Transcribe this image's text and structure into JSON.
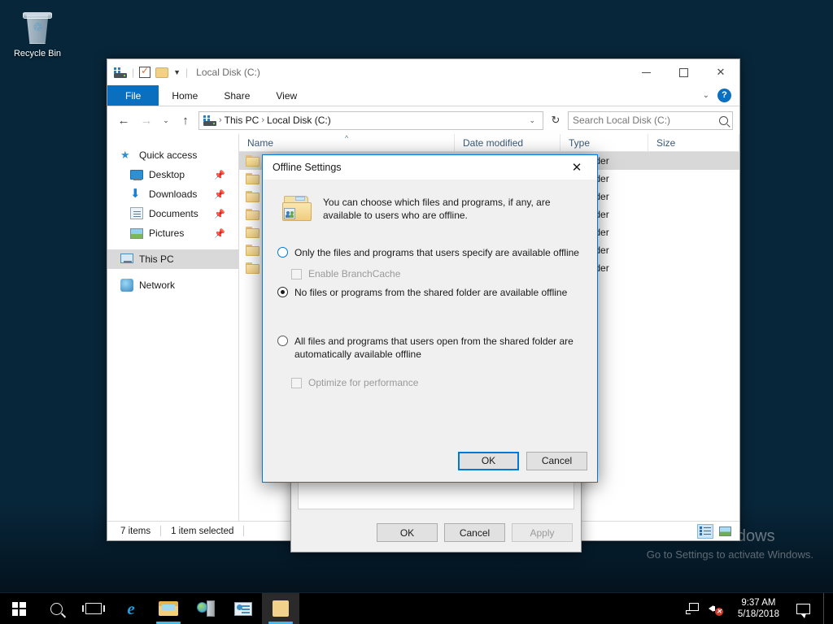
{
  "desktop": {
    "recycle_bin_label": "Recycle Bin",
    "watermark_title": "Activate Windows",
    "watermark_subtitle": "Go to Settings to activate Windows."
  },
  "taskbar": {
    "start_label": "Start",
    "search_label": "Search",
    "task_view_label": "Task View",
    "apps": [
      {
        "name": "internet-explorer",
        "label": "Internet Explorer"
      },
      {
        "name": "file-explorer",
        "label": "File Explorer"
      },
      {
        "name": "server-manager",
        "label": "Server Manager"
      },
      {
        "name": "control-panel",
        "label": "Control Panel"
      },
      {
        "name": "shared-folder-window",
        "label": "Local Disk (C:)"
      }
    ],
    "tray": {
      "network_label": "Network",
      "volume_label": "Volume (muted)",
      "time": "9:37 AM",
      "date": "5/18/2018",
      "action_center_label": "Action Center"
    }
  },
  "explorer": {
    "title": "Local Disk (C:)",
    "quick_access_toolbar": {
      "properties_label": "Properties",
      "new_folder_label": "New folder",
      "customize_label": "Customize Quick Access Toolbar"
    },
    "window_controls": {
      "minimize": "Minimize",
      "maximize": "Maximize",
      "close": "Close"
    },
    "ribbon": {
      "tabs": [
        "File",
        "Home",
        "Share",
        "View"
      ],
      "collapse_label": "Minimize the Ribbon",
      "help_label": "?"
    },
    "nav": {
      "back": "Back",
      "forward": "Forward",
      "recent": "Recent locations",
      "up": "Up",
      "breadcrumb": [
        "This PC",
        "Local Disk (C:)"
      ],
      "refresh_label": "Refresh",
      "search_placeholder": "Search Local Disk (C:)"
    },
    "navigation_pane": [
      {
        "label": "Quick access",
        "icon": "star-icon",
        "pinned": false,
        "selected": false,
        "sub": false
      },
      {
        "label": "Desktop",
        "icon": "desktop-icon",
        "pinned": true,
        "selected": false,
        "sub": true
      },
      {
        "label": "Downloads",
        "icon": "downloads-icon",
        "pinned": true,
        "selected": false,
        "sub": true
      },
      {
        "label": "Documents",
        "icon": "documents-icon",
        "pinned": true,
        "selected": false,
        "sub": true
      },
      {
        "label": "Pictures",
        "icon": "pictures-icon",
        "pinned": true,
        "selected": false,
        "sub": true
      },
      {
        "label": "This PC",
        "icon": "this-pc-icon",
        "pinned": false,
        "selected": true,
        "sub": false
      },
      {
        "label": "Network",
        "icon": "network-icon",
        "pinned": false,
        "selected": false,
        "sub": false
      }
    ],
    "columns": [
      "Name",
      "Date modified",
      "Type",
      "Size"
    ],
    "rows": [
      {
        "name": "",
        "date": "",
        "type": "File folder",
        "size": "",
        "selected": true
      },
      {
        "name": "",
        "date": "",
        "type": "File folder",
        "size": "",
        "selected": false
      },
      {
        "name": "",
        "date": "",
        "type": "File folder",
        "size": "",
        "selected": false
      },
      {
        "name": "",
        "date": "",
        "type": "File folder",
        "size": "",
        "selected": false
      },
      {
        "name": "",
        "date": "",
        "type": "File folder",
        "size": "",
        "selected": false
      },
      {
        "name": "",
        "date": "",
        "type": "File folder",
        "size": "",
        "selected": false
      },
      {
        "name": "",
        "date": "",
        "type": "File folder",
        "size": "",
        "selected": false
      }
    ],
    "status": {
      "item_count": "7 items",
      "selection": "1 item selected",
      "details_view_label": "Details view",
      "tile_view_label": "Large icons view"
    }
  },
  "properties_dialog": {
    "ok_label": "OK",
    "cancel_label": "Cancel",
    "apply_label": "Apply"
  },
  "offline_dialog": {
    "title": "Offline Settings",
    "close_label": "Close",
    "icon_name": "shared-folder-icon",
    "description": "You can choose which files and programs, if any, are available to users who are offline.",
    "options": [
      {
        "label": "Only the files and programs that users specify are available offline",
        "selected": false
      },
      {
        "label": "No files or programs from the shared folder are available offline",
        "selected": true
      },
      {
        "label": "All files and programs that users open from the shared folder are automatically available offline",
        "selected": false
      }
    ],
    "checkboxes": [
      {
        "label": "Enable BranchCache",
        "checked": false,
        "enabled": false
      },
      {
        "label": "Optimize for performance",
        "checked": false,
        "enabled": false
      }
    ],
    "ok_label": "OK",
    "cancel_label": "Cancel"
  },
  "colors": {
    "accent": "#0078d7",
    "ribbon_file_tab": "#0b6fbf",
    "selection_gray": "#d8d8d8",
    "dialog_bg": "#f0f0f0"
  }
}
